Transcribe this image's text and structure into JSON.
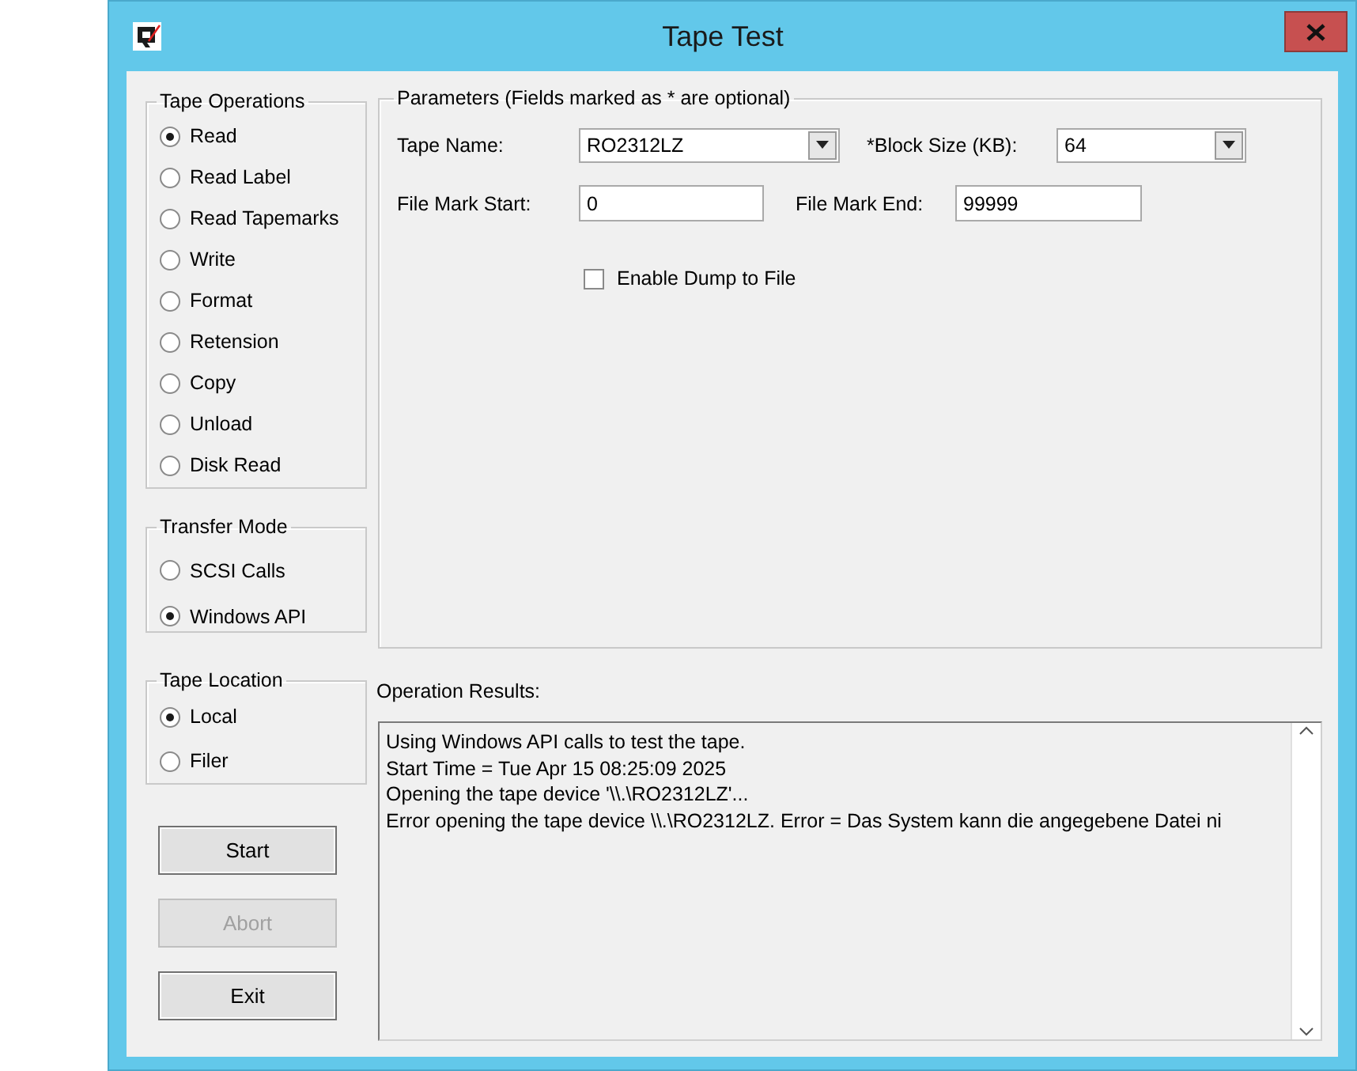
{
  "window": {
    "title": "Tape Test"
  },
  "radio_groups": [
    {
      "title": "Tape Operations",
      "options": [
        {
          "label": "Read",
          "selected": true
        },
        {
          "label": "Read Label",
          "selected": false
        },
        {
          "label": "Read Tapemarks",
          "selected": false
        },
        {
          "label": "Write",
          "selected": false
        },
        {
          "label": "Format",
          "selected": false
        },
        {
          "label": "Retension",
          "selected": false
        },
        {
          "label": "Copy",
          "selected": false
        },
        {
          "label": "Unload",
          "selected": false
        },
        {
          "label": "Disk Read",
          "selected": false
        }
      ]
    },
    {
      "title": "Transfer Mode",
      "options": [
        {
          "label": "SCSI Calls",
          "selected": false
        },
        {
          "label": "Windows API",
          "selected": true
        }
      ]
    },
    {
      "title": "Tape Location",
      "options": [
        {
          "label": "Local",
          "selected": true
        },
        {
          "label": "Filer",
          "selected": false
        }
      ]
    }
  ],
  "parameters": {
    "title": "Parameters (Fields marked as * are optional)",
    "rows": [
      [
        {
          "label": "Tape Name:",
          "kind": "dropdown",
          "value": "RO2312LZ"
        },
        {
          "label": "*Block Size (KB):",
          "kind": "dropdown",
          "value": "64"
        }
      ],
      [
        {
          "label": "File Mark Start:",
          "kind": "text",
          "value": "0"
        },
        {
          "label": "File Mark End:",
          "kind": "text",
          "value": "99999"
        }
      ]
    ],
    "checkbox": {
      "label": "Enable Dump to File",
      "checked": false
    }
  },
  "results": {
    "label": "Operation Results:",
    "lines": [
      "Using Windows API calls to test the tape.",
      "Start Time = Tue Apr 15 08:25:09 2025",
      "Opening the tape device '\\\\.\\RO2312LZ'...",
      "Error opening the tape device \\\\.\\RO2312LZ. Error = Das System kann die angegebene Datei ni"
    ]
  },
  "buttons": [
    {
      "label": "Start",
      "disabled": false
    },
    {
      "label": "Abort",
      "disabled": true
    },
    {
      "label": "Exit",
      "disabled": false
    }
  ]
}
